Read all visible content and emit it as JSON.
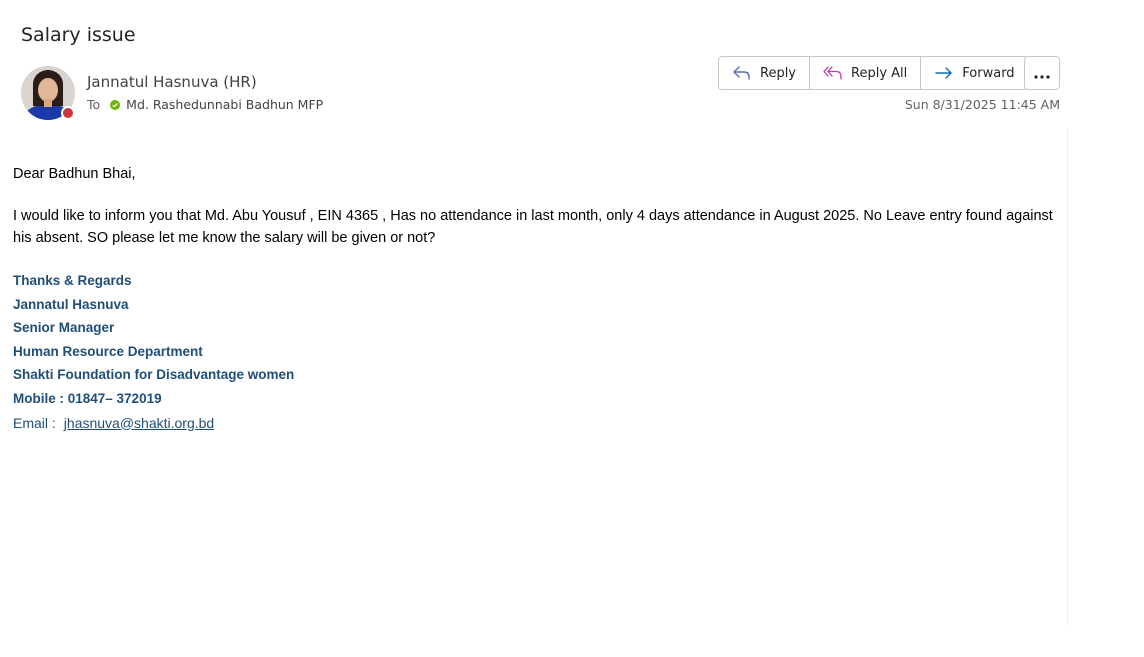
{
  "email": {
    "subject": "Salary issue",
    "sender_name": "Jannatul Hasnuva (HR)",
    "to_label": "To",
    "recipient": "Md. Rashedunnabi Badhun MFP",
    "date": "Sun 8/31/2025 11:45 AM"
  },
  "actions": {
    "reply": "Reply",
    "reply_all": "Reply All",
    "forward": "Forward",
    "more": "•••"
  },
  "body": {
    "greeting": "Dear Badhun Bhai,",
    "paragraph": "I would like to inform you that Md. Abu Yousuf  , EIN 4365 , Has no attendance in last month, only 4 days attendance in August 2025. No Leave entry found against his absent. SO please let me know the salary will be given or not?"
  },
  "signature": {
    "line1": "Thanks & Regards",
    "line2": "Jannatul Hasnuva",
    "line3": "Senior Manager",
    "line4": "Human Resource Department",
    "line5": "Shakti Foundation for Disadvantage women",
    "line6": "Mobile : 01847– 372019",
    "email_label": "Email  :",
    "email_link": "jhasnuva@shakti.org.bd"
  },
  "colors": {
    "signature": "#1f4e79",
    "presence_busy": "#d13438",
    "status_available": "#6bb700",
    "reply_icon": "#5c6bc0",
    "reply_all_icon": "#c239b3",
    "forward_icon": "#0f6cbd"
  },
  "icons": {
    "reply": "reply-arrow-icon",
    "reply_all": "reply-all-icon",
    "forward": "forward-arrow-icon",
    "more": "more-dots-icon"
  }
}
